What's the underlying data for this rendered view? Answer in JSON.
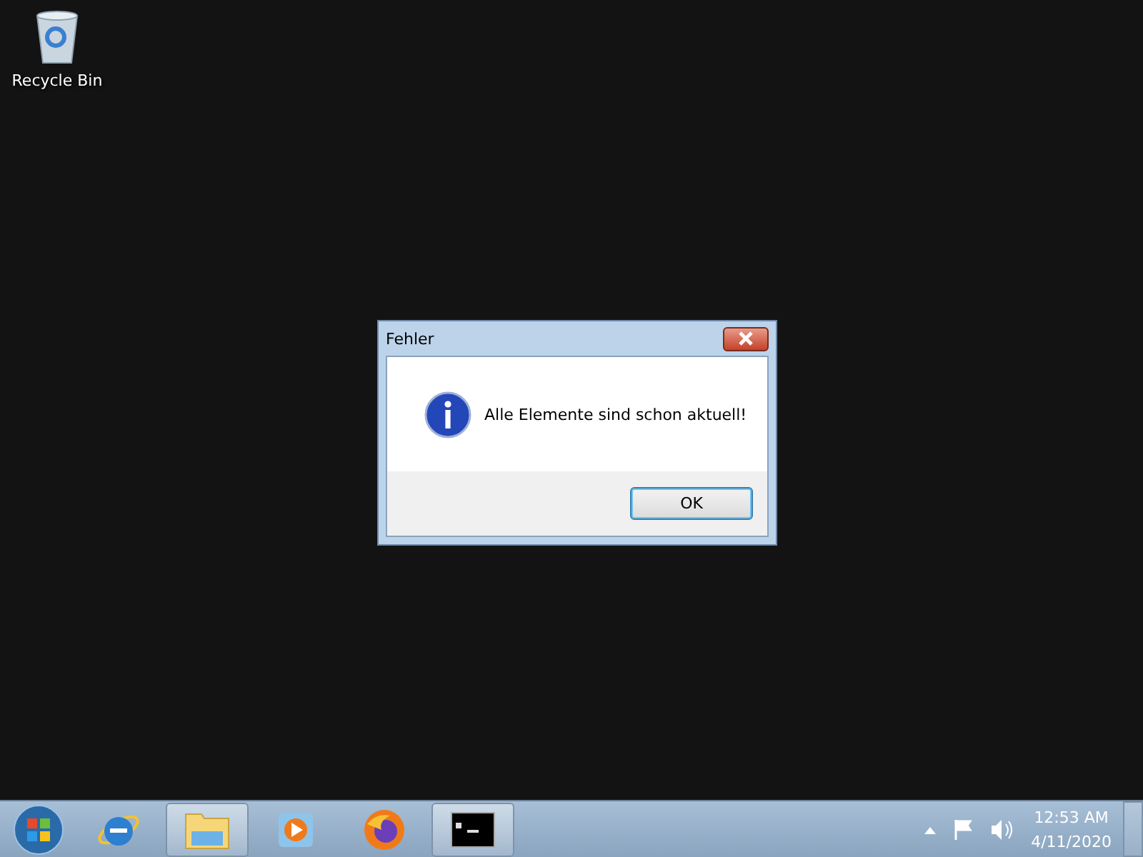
{
  "desktop": {
    "icons": [
      {
        "label": "Recycle Bin",
        "kind": "recycle-bin"
      }
    ]
  },
  "dialog": {
    "title": "Fehler",
    "message": "Alle Elemente sind schon aktuell!",
    "buttons": [
      {
        "label": "OK",
        "selected": true
      }
    ]
  },
  "taskbar": {
    "items": [
      {
        "kind": "ie",
        "open": false
      },
      {
        "kind": "explorer",
        "open": true
      },
      {
        "kind": "media",
        "open": false
      },
      {
        "kind": "firefox",
        "open": false
      },
      {
        "kind": "cmd",
        "open": true
      }
    ],
    "time": "12:53 AM",
    "date": "4/11/2020"
  }
}
